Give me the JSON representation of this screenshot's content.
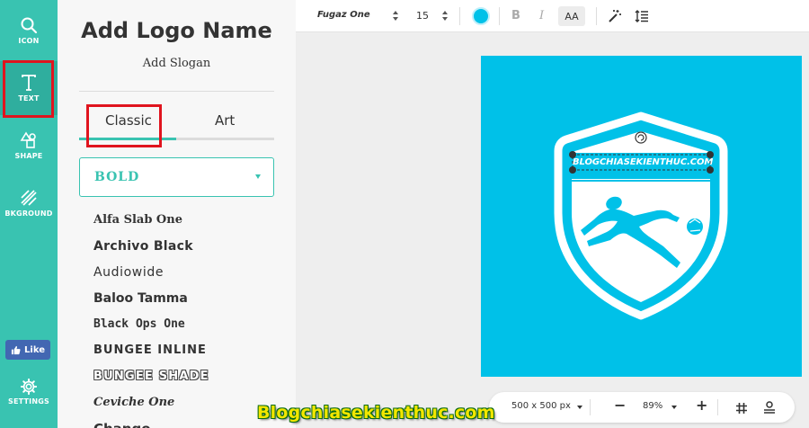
{
  "rail": {
    "items": [
      {
        "label": "ICON",
        "icon": "search-icon"
      },
      {
        "label": "TEXT",
        "icon": "text-t-icon"
      },
      {
        "label": "SHAPE",
        "icon": "shapes-icon"
      },
      {
        "label": "BKGROUND",
        "icon": "hatch-icon"
      },
      {
        "label": "SETTINGS",
        "icon": "gear-icon"
      }
    ],
    "like_label": "Like"
  },
  "panel": {
    "logo_name": "Add Logo Name",
    "slogan": "Add Slogan",
    "tabs": [
      {
        "label": "Classic",
        "active": true
      },
      {
        "label": "Art",
        "active": false
      }
    ],
    "category": "BOLD",
    "fonts": [
      "Alfa Slab One",
      "Archivo Black",
      "Audiowide",
      "Baloo Tamma",
      "Black Ops One",
      "BUNGEE INLINE",
      "BUNGEE SHADE",
      "Ceviche One",
      "Chango"
    ]
  },
  "toolbar": {
    "font": "Fugaz One",
    "size": "15",
    "text_color": "#00c1e8",
    "bold": "B",
    "italic": "I",
    "case": "AA"
  },
  "canvas": {
    "background": "#00c1e8",
    "logo_text": "BLOGCHIASEKIENTHUC.COM"
  },
  "bottombar": {
    "size": "500 x 500 px",
    "zoom": "89%",
    "minus": "−",
    "plus": "+"
  },
  "watermark": "Blogchiasekienthuc.com",
  "colors": {
    "accent": "#39c3b1",
    "highlight": "#e0141e",
    "facebook": "#4267b2"
  }
}
